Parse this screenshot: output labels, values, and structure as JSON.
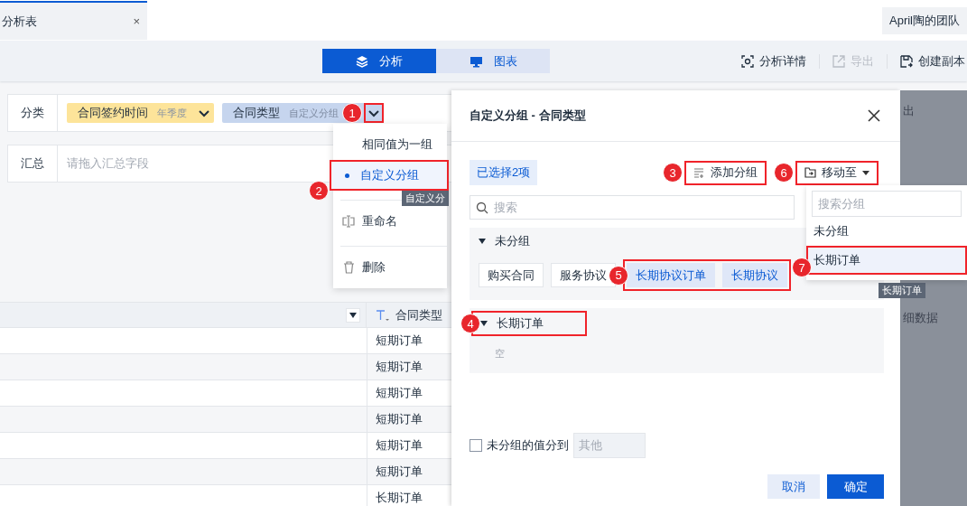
{
  "tab": {
    "title": "分析表",
    "close": "×"
  },
  "team": "April陶的团队",
  "view_switch": [
    {
      "label": "分析",
      "selected": true
    },
    {
      "label": "图表",
      "selected": false
    }
  ],
  "toolbar_actions": [
    {
      "label": "分析详情",
      "disabled": false
    },
    {
      "label": "导出",
      "disabled": true
    },
    {
      "label": "创建副本",
      "disabled": false
    }
  ],
  "category": {
    "label": "分类",
    "tags": [
      {
        "name": "合同签约时间",
        "detail": "年季度",
        "color": "#fde49a",
        "highlighted": false
      },
      {
        "name": "合同类型",
        "detail": "自定义分组",
        "color": "#c6d5ee",
        "highlighted": true,
        "step": "1"
      }
    ]
  },
  "summary": {
    "label": "汇总",
    "placeholder": "请拖入汇总字段"
  },
  "field_menu": {
    "items": [
      {
        "label": "相同值为一组",
        "selected": false,
        "highlighted": false
      },
      {
        "label": "自定义分组",
        "selected": true,
        "highlighted": true,
        "step": "2"
      },
      {
        "label": "重命名",
        "selected": false,
        "highlighted": false
      },
      {
        "label": "删除",
        "selected": false,
        "highlighted": false
      }
    ],
    "tooltip": "自定义分"
  },
  "table": {
    "column": "合同类型",
    "rows": [
      "短期订单",
      "短期订单",
      "短期订单",
      "短期订单",
      "短期订单",
      "短期订单",
      "长期订单"
    ]
  },
  "backdrop_texts": [
    "出",
    "细数据"
  ],
  "dialog": {
    "title": "自定义分组 - 合同类型",
    "selection_count": "已选择2项",
    "add_group": {
      "label": "添加分组",
      "highlighted": true,
      "step": "3"
    },
    "move_to": {
      "label": "移动至",
      "highlighted": true,
      "step": "6",
      "search_placeholder": "搜索分组",
      "items": [
        {
          "label": "未分组",
          "selected": false,
          "highlighted": false
        },
        {
          "label": "长期订单",
          "selected": true,
          "highlighted": true,
          "step": "7"
        }
      ],
      "tooltip": "长期订单"
    },
    "search_placeholder": "搜索",
    "groups": [
      {
        "name": "未分组",
        "expanded": true,
        "highlighted": false,
        "selection_step": "5",
        "values": [
          {
            "label": "购买合同",
            "selected": false
          },
          {
            "label": "服务协议",
            "selected": false
          },
          {
            "label": "长期协议订单",
            "selected": true
          },
          {
            "label": "长期协议",
            "selected": true
          }
        ]
      },
      {
        "name": "长期订单",
        "expanded": true,
        "highlighted": true,
        "step": "4",
        "empty_text": "空"
      }
    ],
    "remainder": {
      "checked": false,
      "label": "未分组的值分到",
      "value": "其他"
    },
    "buttons": [
      {
        "label": "取消",
        "kind": "secondary"
      },
      {
        "label": "确定",
        "kind": "primary"
      }
    ]
  }
}
